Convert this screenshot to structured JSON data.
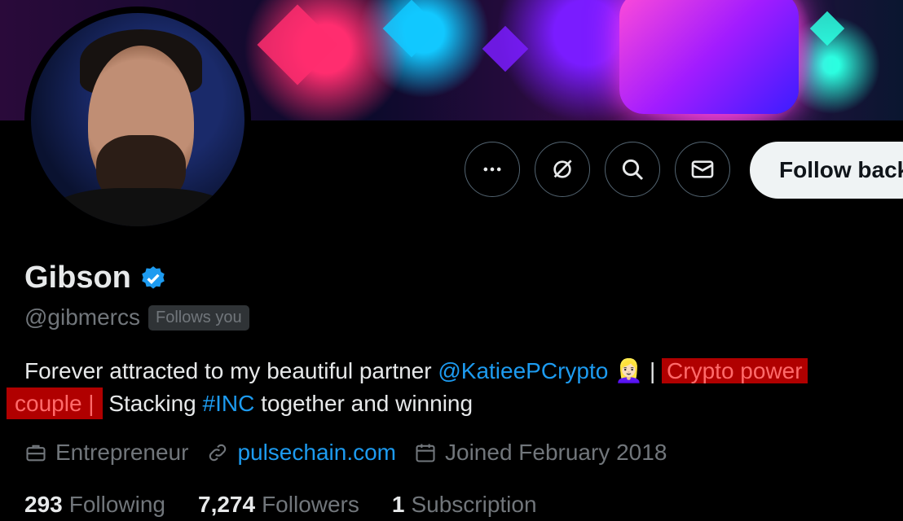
{
  "profile": {
    "name": "Gibson",
    "handle": "@gibmercs",
    "follows_you": "Follows you",
    "bio": {
      "part1": "Forever attracted to my beautiful partner ",
      "mention": "@KatieePCrypto",
      "emoji": "👱🏻‍♀️",
      "sep": " | ",
      "highlight1": "Crypto power",
      "highlight2": "couple |",
      "part2": " Stacking ",
      "hashtag": "#INC",
      "part3": " together and winning"
    },
    "meta": {
      "profession": "Entrepreneur",
      "website": "pulsechain.com",
      "joined": "Joined February 2018"
    },
    "stats": {
      "following_count": "293",
      "following_label": "Following",
      "followers_count": "7,274",
      "followers_label": "Followers",
      "subscription_count": "1",
      "subscription_label": "Subscription"
    }
  },
  "actions": {
    "follow_back": "Follow back"
  },
  "icons": {
    "more": "more-icon",
    "grok": "grok-icon",
    "search": "search-icon",
    "message": "envelope-icon",
    "verified": "verified-badge-icon",
    "briefcase": "briefcase-icon",
    "link": "link-icon",
    "calendar": "calendar-icon"
  },
  "colors": {
    "background": "#000000",
    "link": "#1d9bf0",
    "muted": "#71767b",
    "highlight_bg": "#b00000",
    "highlight_text": "#ff6b6b"
  }
}
